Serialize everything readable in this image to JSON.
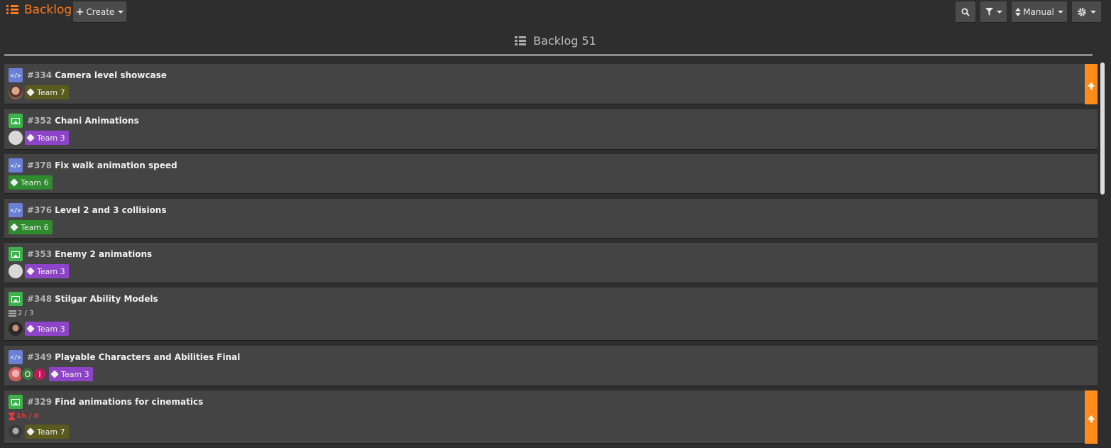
{
  "app": {
    "title": "Backlog"
  },
  "toolbar": {
    "create_label": "Create",
    "sort_label": "Manual"
  },
  "column": {
    "name": "Backlog",
    "count": "51"
  },
  "colors": {
    "accent": "#ff7a1a",
    "priority": "#ff8c1a",
    "type_code": "#6b7fd6",
    "type_image": "#3bb34a",
    "team7": "#5a5a1e",
    "team3": "#8e44c8",
    "team6": "#2e8b2e"
  },
  "cards": [
    {
      "id": "#334",
      "title": "Camera level showcase",
      "type": "code-icon",
      "tag": "Team 7",
      "avatars": [
        "face"
      ],
      "priority": true
    },
    {
      "id": "#352",
      "title": "Chani Animations",
      "type": "image-icon",
      "tag": "Team 3",
      "avatars": [
        "blank"
      ],
      "priority": false
    },
    {
      "id": "#378",
      "title": "Fix walk animation speed",
      "type": "code-icon",
      "tag": "Team 6",
      "avatars": [],
      "priority": false
    },
    {
      "id": "#376",
      "title": "Level 2 and 3 collisions",
      "type": "code-icon",
      "tag": "Team 6",
      "avatars": [],
      "priority": false
    },
    {
      "id": "#353",
      "title": "Enemy 2 animations",
      "type": "image-icon",
      "tag": "Team 3",
      "avatars": [
        "blank"
      ],
      "priority": false
    },
    {
      "id": "#348",
      "title": "Stilgar Ability Models",
      "type": "image-icon",
      "tag": "Team 3",
      "avatars": [
        "dark"
      ],
      "checklist": "2 / 3",
      "priority": false
    },
    {
      "id": "#349",
      "title": "Playable Characters and Abilities Final",
      "type": "code-icon",
      "tag": "Team 3",
      "avatars": [
        "pink"
      ],
      "initials": [
        "O",
        "I"
      ],
      "priority": false
    },
    {
      "id": "#329",
      "title": "Find animations for cinematics",
      "type": "image-icon",
      "tag": "Team 7",
      "avatars": [
        "grey"
      ],
      "time": "1h / 0",
      "priority": true
    }
  ]
}
